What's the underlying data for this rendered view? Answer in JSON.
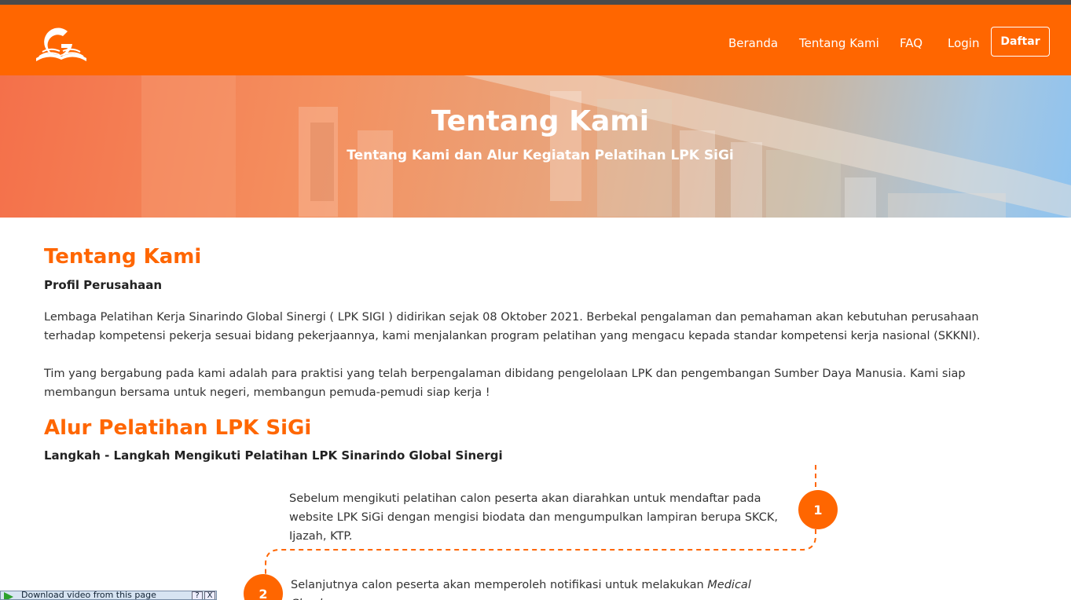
{
  "nav": {
    "logo_icon": "book-g-logo-icon",
    "items": [
      {
        "label": "Beranda"
      },
      {
        "label": "Tentang Kami"
      },
      {
        "label": "FAQ"
      },
      {
        "label": "Login"
      }
    ],
    "register_label": "Daftar"
  },
  "hero": {
    "title": "Tentang Kami",
    "subtitle": "Tentang Kami dan Alur Kegiatan Pelatihan LPK SiGi"
  },
  "about": {
    "heading": "Tentang Kami",
    "subheading": "Profil Perusahaan",
    "paragraphs": [
      "Lembaga Pelatihan Kerja Sinarindo Global Sinergi ( LPK SIGI ) didirikan sejak 08 Oktober 2021. Berbekal pengalaman dan pemahaman akan kebutuhan perusahaan terhadap kompetensi pekerja sesuai bidang pekerjaannya, kami menjalankan program pelatihan yang mengacu kepada standar kompetensi kerja nasional (SKKNI).",
      "Tim yang bergabung pada kami adalah para praktisi yang telah berpengalaman dibidang pengelolaan LPK dan pengembangan Sumber Daya Manusia. Kami siap membangun bersama untuk negeri, membangun pemuda-pemudi siap kerja !"
    ]
  },
  "flow": {
    "heading": "Alur Pelatihan LPK SiGi",
    "subheading": "Langkah - Langkah Mengikuti Pelatihan LPK Sinarindo Global Sinergi",
    "steps": [
      {
        "number": "1",
        "text": "Sebelum mengikuti pelatihan calon peserta akan diarahkan untuk mendaftar pada website LPK SiGi dengan mengisi biodata dan mengumpulkan lampiran berupa SKCK, Ijazah, KTP."
      },
      {
        "number": "2",
        "text_before": "Selanjutnya calon peserta akan memperoleh notifikasi untuk melakukan ",
        "text_em": "Medical Checkup"
      }
    ]
  },
  "download_bar": {
    "label": "Download video from this page",
    "help": "?",
    "close": "X"
  },
  "colors": {
    "brand": "#ff6600",
    "text": "#333333"
  }
}
